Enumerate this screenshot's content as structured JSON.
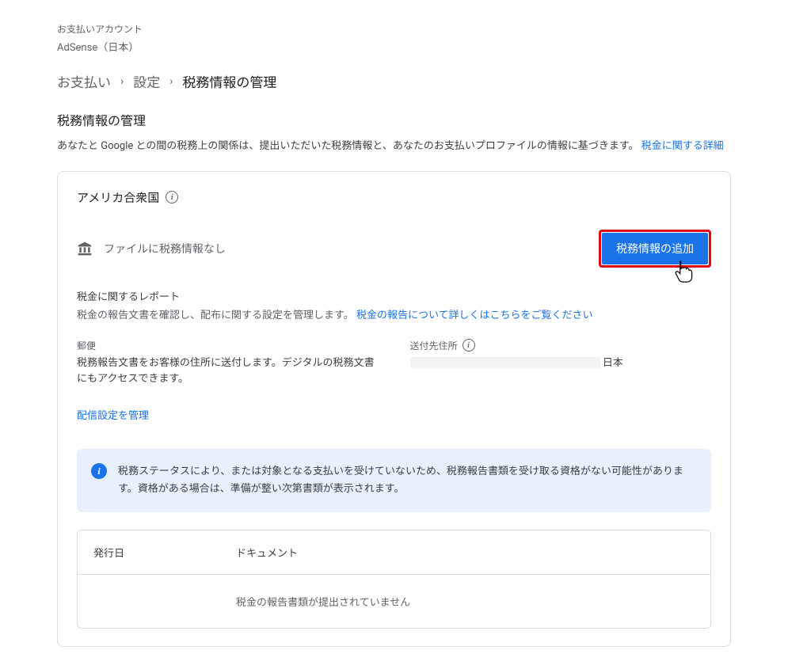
{
  "account": {
    "label": "お支払いアカウント",
    "name": "AdSense（日本）"
  },
  "breadcrumb": {
    "items": [
      "お支払い",
      "設定",
      "税務情報の管理"
    ]
  },
  "page": {
    "title": "税務情報の管理",
    "description": "あなたと Google との間の税務上の関係は、提出いただいた税務情報と、あなたのお支払いプロファイルの情報に基づきます。",
    "detailsLink": "税金に関する詳細"
  },
  "card": {
    "country": "アメリカ合衆国",
    "statusText": "ファイルに税務情報なし",
    "addButton": "税務情報の追加",
    "report": {
      "label": "税金に関するレポート",
      "description": "税金の報告文書を確認し、配布に関する設定を管理します。",
      "link": "税金の報告について詳しくはこちらをご覧ください"
    },
    "mail": {
      "label": "郵便",
      "content": "税務報告文書をお客様の住所に送付します。デジタルの税務文書にもアクセスできます。"
    },
    "address": {
      "label": "送付先住所",
      "country": "日本"
    },
    "manageLink": "配信設定を管理",
    "banner": "税務ステータスにより、または対象となる支払いを受けていないため、税務報告書類を受け取る資格がない可能性があります。資格がある場合は、準備が整い次第書類が表示されます。",
    "table": {
      "colDate": "発行日",
      "colDoc": "ドキュメント",
      "empty": "税金の報告書類が提出されていません"
    }
  }
}
